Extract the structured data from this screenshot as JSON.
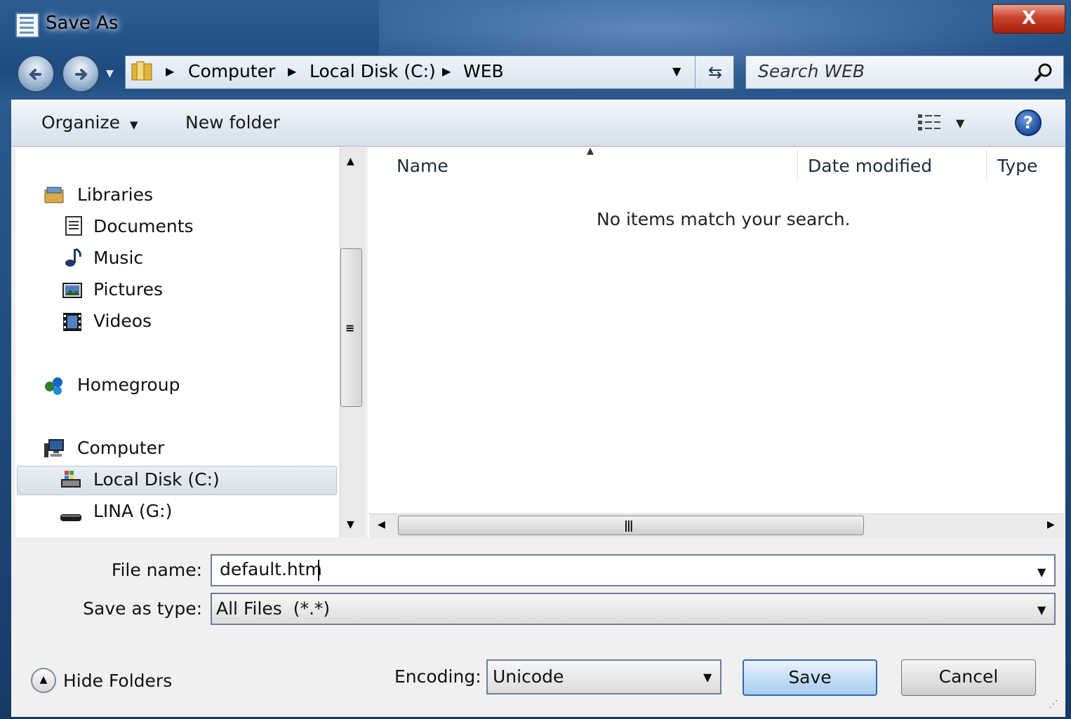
{
  "window": {
    "title": "Save As",
    "close_label": "X"
  },
  "address": {
    "crumbs": [
      "Computer",
      "Local Disk (C:)",
      "WEB"
    ],
    "refresh_glyph": "⇆"
  },
  "search": {
    "placeholder": "Search WEB"
  },
  "toolbar": {
    "organize_label": "Organize",
    "new_folder_label": "New folder",
    "help_label": "?"
  },
  "navpane": {
    "libraries": "Libraries",
    "library_items": [
      "Documents",
      "Music",
      "Pictures",
      "Videos"
    ],
    "homegroup": "Homegroup",
    "computer": "Computer",
    "drives": [
      "Local Disk (C:)",
      "LINA (G:)"
    ],
    "selected": "Local Disk (C:)"
  },
  "filelist": {
    "columns": [
      "Name",
      "Date modified",
      "Type"
    ],
    "empty_message": "No items match your search."
  },
  "form": {
    "file_name_label": "File name:",
    "file_name_value": "default.htm",
    "save_type_label": "Save as type:",
    "save_type_value": "All Files  (*.*)",
    "encoding_label": "Encoding:",
    "encoding_value": "Unicode"
  },
  "buttons": {
    "save": "Save",
    "cancel": "Cancel",
    "hide_folders": "Hide Folders"
  },
  "colors": {
    "accent": "#2f6bb3",
    "close": "#c9432c"
  }
}
